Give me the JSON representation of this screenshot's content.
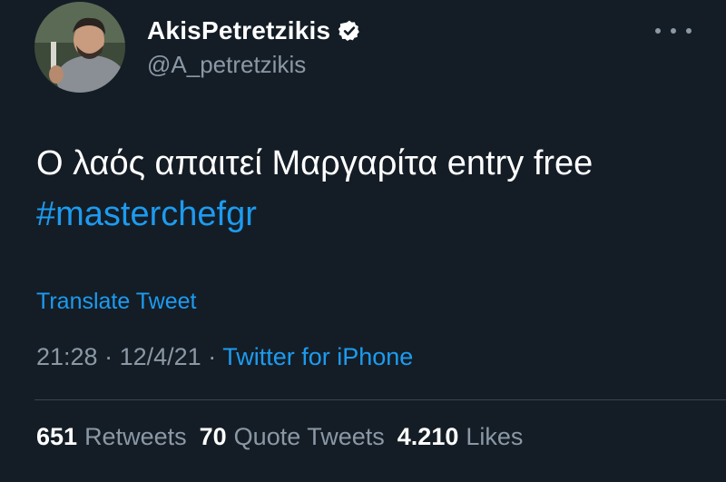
{
  "tweet": {
    "author": {
      "display_name": "AkisPetretzikis",
      "handle": "@A_petretzikis",
      "verified_icon": "verified-badge-icon",
      "avatar_icon": "avatar-photo"
    },
    "more_icon": "more-options-icon",
    "text": "Ο λαός απαιτεί Μαργαρίτα entry free",
    "hashtag": "#masterchefgr",
    "translate_label": "Translate Tweet",
    "time": "21:28",
    "separator": "·",
    "date": "12/4/21",
    "source": "Twitter for iPhone",
    "stats": {
      "retweets_count": "651",
      "retweets_label": "Retweets",
      "quotes_count": "70",
      "quotes_label": "Quote Tweets",
      "likes_count": "4.210",
      "likes_label": "Likes"
    }
  },
  "colors": {
    "background": "#141d26",
    "link": "#1d9bf0",
    "secondary_text": "#8b98a5",
    "primary_text": "#ffffff"
  }
}
